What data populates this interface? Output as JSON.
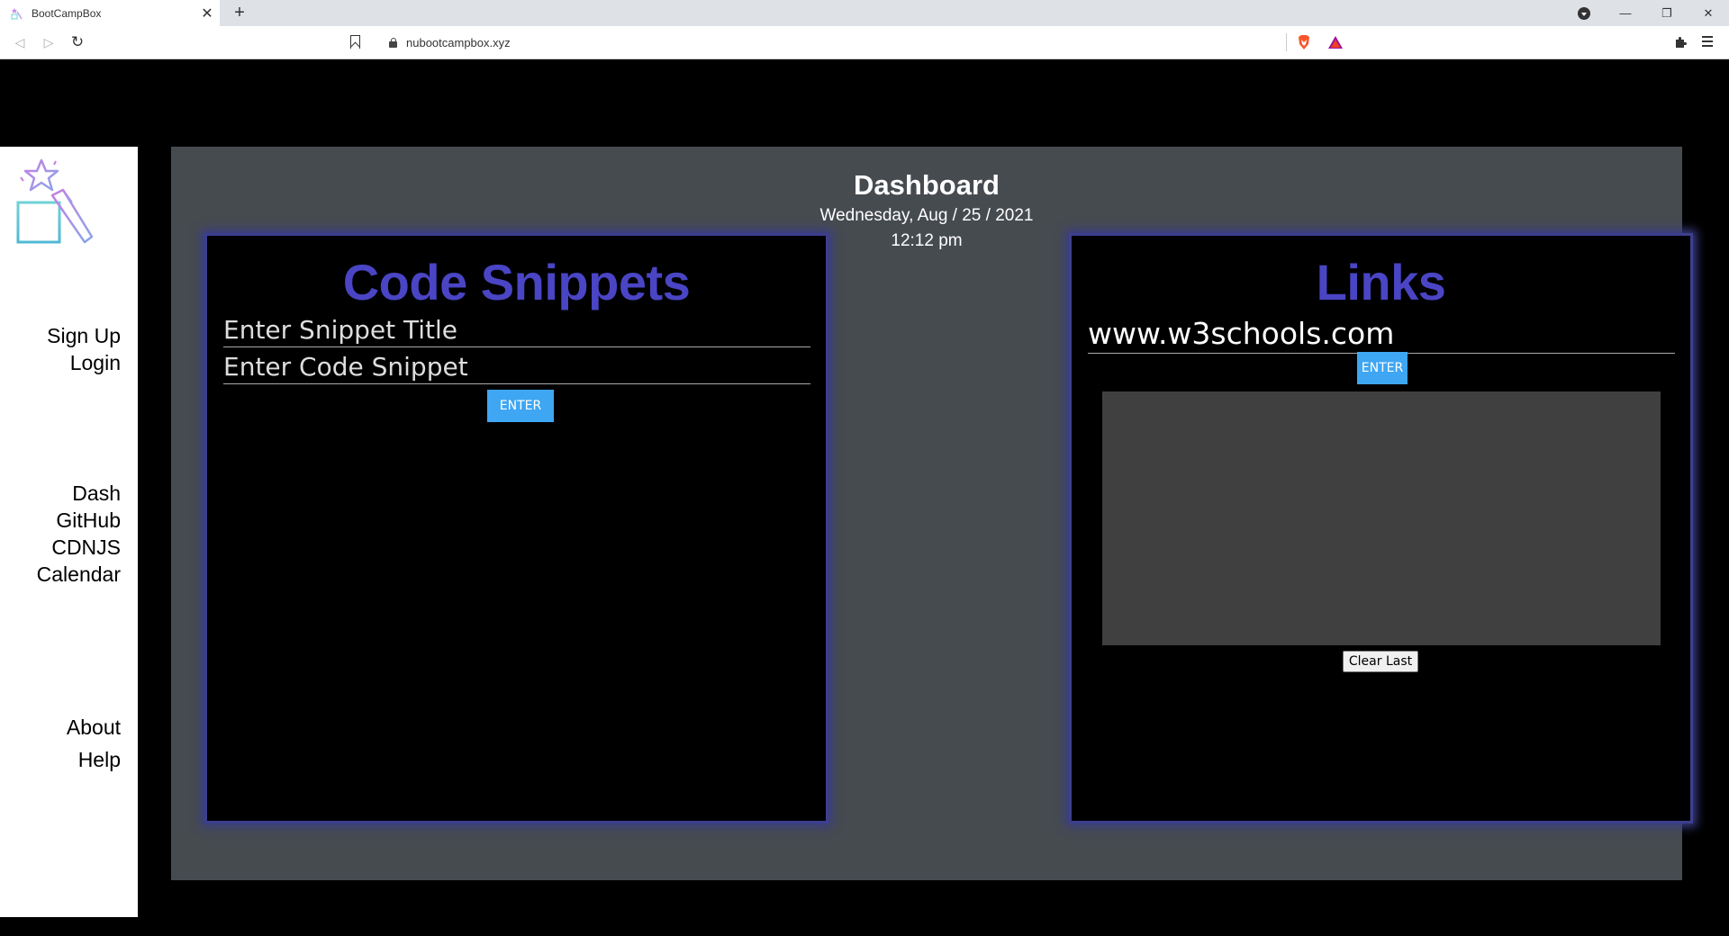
{
  "browser": {
    "tab_title": "BootCampBox",
    "tab_close": "✕",
    "new_tab": "+",
    "url": "nubootcampbox.xyz",
    "controls": {
      "minimize": "—",
      "restore": "❐",
      "close": "✕"
    }
  },
  "sidebar": {
    "auth_links": [
      "Sign Up",
      "Login"
    ],
    "nav_links": [
      "Dash",
      "GitHub",
      "CDNJS",
      "Calendar"
    ],
    "info_links": [
      "About",
      "Help"
    ]
  },
  "dashboard": {
    "title": "Dashboard",
    "date": "Wednesday, Aug / 25 / 2021",
    "time": "12:12 pm"
  },
  "snippets": {
    "title": "Code Snippets",
    "title_placeholder": "Enter Snippet Title",
    "code_placeholder": "Enter Code Snippet",
    "enter_label": "ENTER"
  },
  "links": {
    "title": "Links",
    "link_value": "www.w3schools.com",
    "enter_label": "ENTER",
    "clear_label": "Clear Last"
  },
  "colors": {
    "panel_title": "#4a45c4",
    "panel_border": "#3c3f8f",
    "enter_button": "#3ea6f3",
    "main_bg": "#464b50"
  }
}
